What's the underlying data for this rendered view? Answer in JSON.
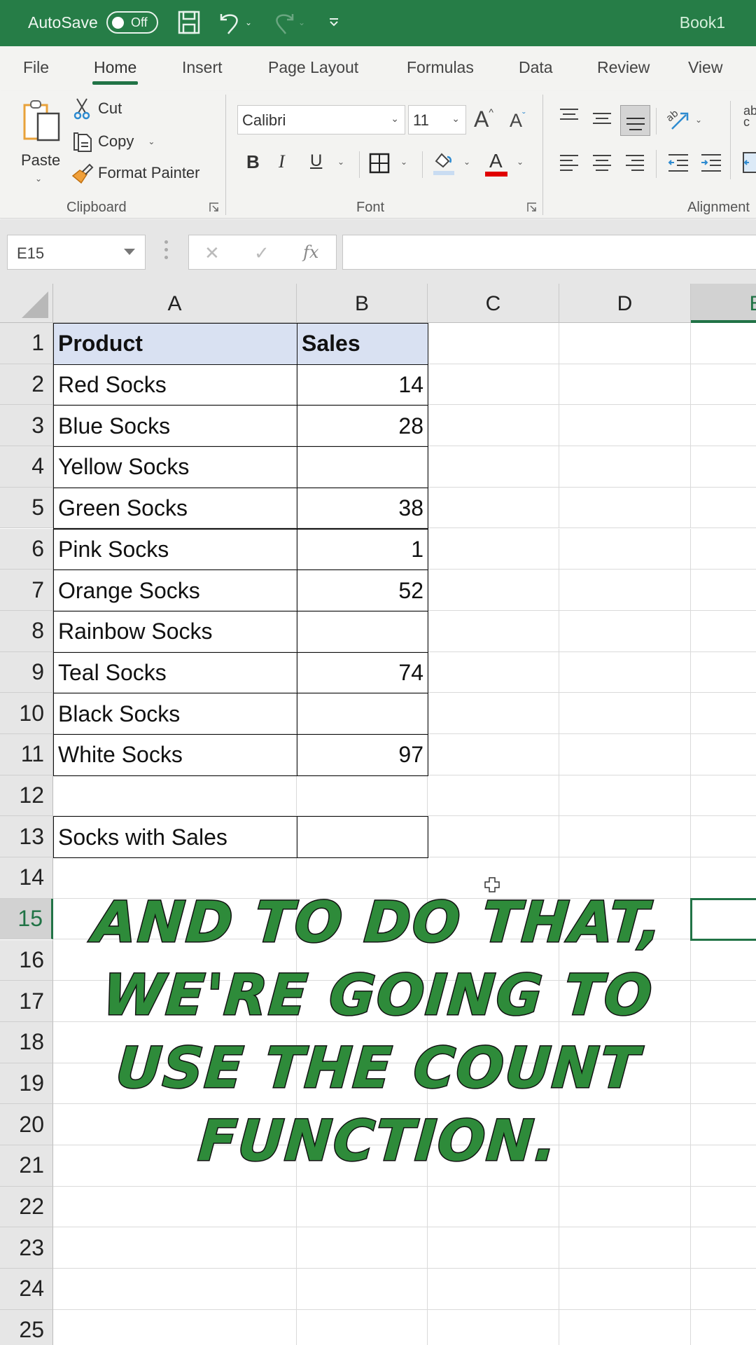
{
  "titlebar": {
    "autosave_label": "AutoSave",
    "autosave_state": "Off",
    "document_title": "Book1",
    "qat_icons": [
      "save-icon",
      "undo-icon",
      "redo-icon",
      "customize-qat-icon"
    ]
  },
  "tabs": [
    {
      "label": "File",
      "active": false
    },
    {
      "label": "Home",
      "active": true
    },
    {
      "label": "Insert",
      "active": false
    },
    {
      "label": "Page Layout",
      "active": false
    },
    {
      "label": "Formulas",
      "active": false
    },
    {
      "label": "Data",
      "active": false
    },
    {
      "label": "Review",
      "active": false
    },
    {
      "label": "View",
      "active": false
    }
  ],
  "ribbon": {
    "clipboard": {
      "group_label": "Clipboard",
      "paste_label": "Paste",
      "cut_label": "Cut",
      "copy_label": "Copy",
      "format_painter_label": "Format Painter"
    },
    "font": {
      "group_label": "Font",
      "font_name": "Calibri",
      "font_size": "11",
      "bold_label": "B",
      "italic_label": "I",
      "underline_label": "U",
      "increase_label": "A",
      "decrease_label": "A",
      "font_color_label": "A",
      "font_color": "#e00000"
    },
    "alignment": {
      "group_label": "Alignment"
    }
  },
  "formula_bar": {
    "name_box": "E15",
    "cancel_icon": "✕",
    "enter_icon": "✓",
    "fx_label": "fx",
    "formula": ""
  },
  "sheet": {
    "columns": [
      "A",
      "B",
      "C",
      "D",
      "E"
    ],
    "selected_column": "E",
    "selected_row": 15,
    "active_cell": "E15",
    "rows": [
      "1",
      "2",
      "3",
      "4",
      "5",
      "6",
      "7",
      "8",
      "9",
      "10",
      "11",
      "12",
      "13",
      "14",
      "15",
      "16",
      "17",
      "18",
      "19",
      "20",
      "21",
      "22",
      "23",
      "24",
      "25"
    ],
    "table_header": {
      "product": "Product",
      "sales": "Sales"
    },
    "table_rows": [
      {
        "product": "Red Socks",
        "sales": "14"
      },
      {
        "product": "Blue Socks",
        "sales": "28"
      },
      {
        "product": "Yellow Socks",
        "sales": ""
      },
      {
        "product": "Green Socks",
        "sales": "38"
      },
      {
        "product": "Pink Socks",
        "sales": "1"
      },
      {
        "product": "Orange Socks",
        "sales": "52"
      },
      {
        "product": "Rainbow Socks",
        "sales": ""
      },
      {
        "product": "Teal Socks",
        "sales": "74"
      },
      {
        "product": "Black Socks",
        "sales": ""
      },
      {
        "product": "White Socks",
        "sales": "97"
      }
    ],
    "summary": {
      "label": "Socks with Sales",
      "value": ""
    }
  },
  "caption": {
    "lines": [
      "And to do that,",
      "we're going to",
      "use the COUNT",
      "function."
    ],
    "color": "#2e8b3a"
  },
  "colors": {
    "accent": "#217346",
    "titlebar": "#267d47",
    "header_fill": "#d9e1f2"
  }
}
